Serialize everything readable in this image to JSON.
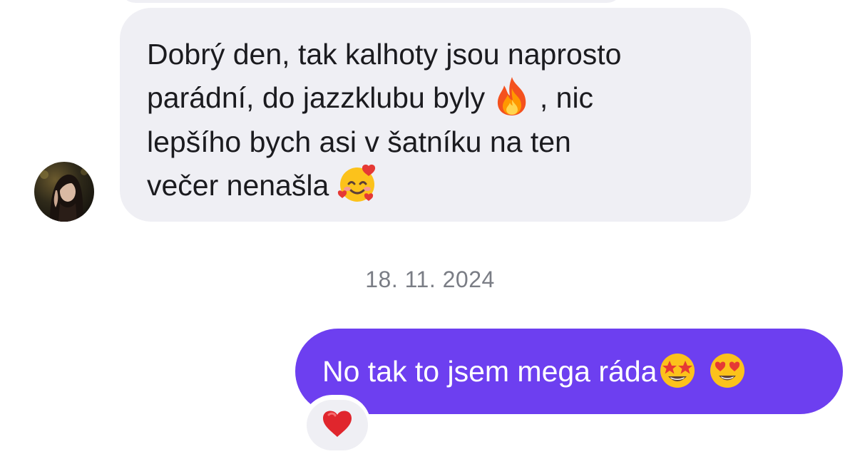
{
  "conversation": {
    "incoming_message": {
      "parts": {
        "line1": "Dobrý den, tak kalhoty jsou naprosto\nparádní, do jazzklubu byly ",
        "line2": " , nic\nlepšího bych asi v šatníku na ten\nvečer nenašla "
      },
      "emojis": [
        "fire-emoji",
        "smiling-face-with-hearts-emoji"
      ]
    },
    "date_separator": "18. 11. 2024",
    "outgoing_message": {
      "text": "No tak to jsem mega ráda",
      "emojis": [
        "star-struck-emoji",
        "heart-eyes-emoji"
      ]
    },
    "reaction": {
      "emoji": "red-heart-emoji"
    }
  },
  "colors": {
    "incoming_bubble": "#efeff4",
    "outgoing_bubble": "#6d3ff0",
    "date_text": "#7a7d85",
    "background": "#ffffff"
  }
}
